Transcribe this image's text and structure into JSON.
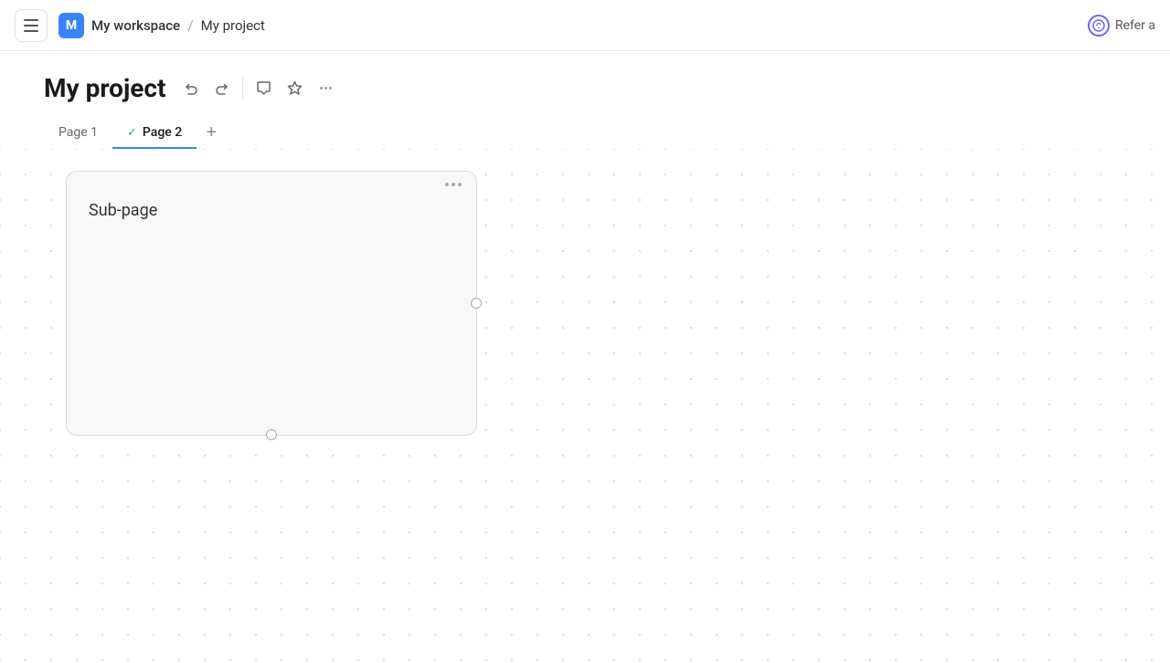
{
  "nav": {
    "hamburger_label": "Menu",
    "workspace_initial": "M",
    "workspace_name": "My workspace",
    "breadcrumb_separator": "/",
    "project_name": "My project",
    "refer_text": "Refer a"
  },
  "header": {
    "title": "My project",
    "undo_label": "Undo",
    "redo_label": "Redo",
    "comment_label": "Comment",
    "star_label": "Star",
    "more_label": "More"
  },
  "tabs": [
    {
      "label": "Page 1",
      "active": false,
      "checked": false
    },
    {
      "label": "Page 2",
      "active": true,
      "checked": true
    }
  ],
  "tabs_add_label": "+",
  "canvas": {
    "card": {
      "title": "Sub-page"
    }
  }
}
